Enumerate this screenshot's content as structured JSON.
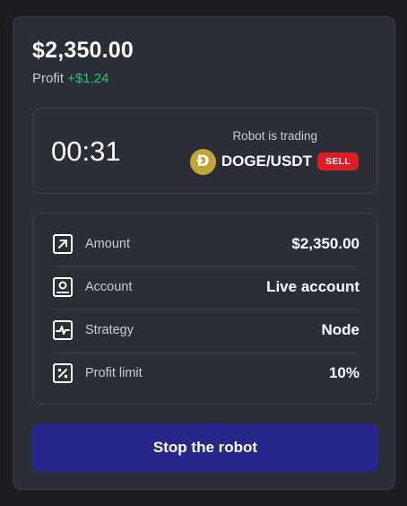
{
  "balance": "$2,350.00",
  "profit": {
    "label": "Profit",
    "value": "+$1.24"
  },
  "session": {
    "timer": "00:31",
    "status": "Robot is trading",
    "pair": "DOGE/USDT",
    "side_badge": "SELL",
    "coin_symbol": "Ð",
    "coin_icon": "doge-coin-icon"
  },
  "details": [
    {
      "label": "Amount",
      "value": "$2,350.00",
      "icon": "arrow-up-right-icon"
    },
    {
      "label": "Account",
      "value": "Live account",
      "icon": "user-card-icon"
    },
    {
      "label": "Strategy",
      "value": "Node",
      "icon": "pulse-chart-icon"
    },
    {
      "label": "Profit limit",
      "value": "10%",
      "icon": "percent-icon"
    }
  ],
  "action": {
    "stop_label": "Stop the robot"
  },
  "colors": {
    "profit_positive": "#2ec56a",
    "sell": "#e01b24",
    "primary_button": "#26268b",
    "doge": "#c2a633"
  }
}
